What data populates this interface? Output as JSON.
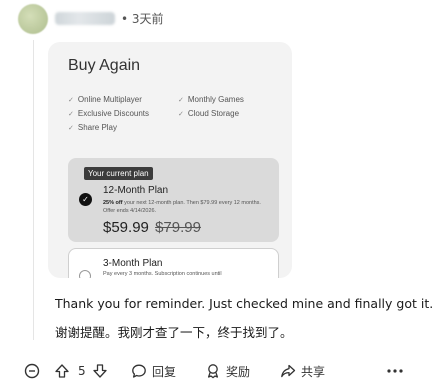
{
  "comment": {
    "time": "• 3天前",
    "text_en": "Thank you for reminder. Just checked mine and finally got it.",
    "text_zh": "谢谢提醒。我刚才查了一下，终于找到了。"
  },
  "screenshot_card": {
    "title": "Buy Again",
    "features_left": [
      "Online Multiplayer",
      "Exclusive Discounts",
      "Share Play"
    ],
    "features_right": [
      "Monthly Games",
      "Cloud Storage"
    ],
    "current_plan_badge": "Your current plan",
    "plan1": {
      "name": "12-Month Plan",
      "desc_bold": "25% off",
      "desc_rest": " your next 12-month plan. Then $79.99 every 12 months. Offer ends 4/14/2026.",
      "price": "$59.99",
      "old_price": "$79.99"
    },
    "plan2": {
      "name": "3-Month Plan",
      "desc": "Pay every 3 months. Subscription continues until"
    }
  },
  "actions": {
    "vote_count": "5",
    "reply_label": "回复",
    "award_label": "奖励",
    "share_label": "共享"
  },
  "icons": {
    "collapse": "minus-circle-icon",
    "upvote": "arrow-up-icon",
    "downvote": "arrow-down-icon",
    "reply": "comment-bubble-icon",
    "award": "award-icon",
    "share": "share-arrow-icon",
    "more": "more-icon"
  }
}
